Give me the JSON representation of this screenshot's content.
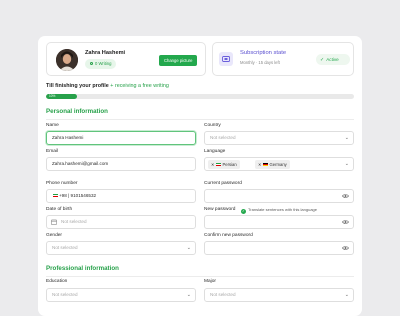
{
  "profile": {
    "name": "Zahra Hashemi",
    "badge": "0 Writing",
    "change_picture": "Change picture"
  },
  "subscription": {
    "title": "Subscription state",
    "detail": "Monthly · 15 days left",
    "status": "Active"
  },
  "progress": {
    "title": "Till finishing your profile",
    "extra": "+ receiving a free writing",
    "percent_label": "10%",
    "value": 0.1
  },
  "personal": {
    "title": "Personal information",
    "fields": {
      "name": {
        "label": "Name",
        "value": "Zahra Hashemi"
      },
      "country": {
        "label": "Country",
        "placeholder": "Not selected"
      },
      "email": {
        "label": "Email",
        "value": "Zahra.hashemi@gmail.com"
      },
      "language": {
        "label": "Language",
        "tags": [
          "Persian",
          "Germany"
        ],
        "translate_label": "Translate sentences with this language",
        "translate_checked": true
      },
      "phone": {
        "label": "Phone number",
        "value": "+98 | 9101546532"
      },
      "current_password": {
        "label": "Current password"
      },
      "dob": {
        "label": "Date of birth",
        "placeholder": "Not selected"
      },
      "new_password": {
        "label": "New password"
      },
      "gender": {
        "label": "Gender",
        "placeholder": "Not selected"
      },
      "confirm_password": {
        "label": "Confirm new password"
      }
    }
  },
  "professional": {
    "title": "Professional information",
    "fields": {
      "education": {
        "label": "Education",
        "placeholder": "Not selected"
      },
      "major": {
        "label": "Major",
        "placeholder": "Not selected"
      }
    }
  },
  "colors": {
    "brand_green": "#27a14a",
    "subscription_purple": "#5a4fd0",
    "background": "#ebebed"
  },
  "icons": {
    "chevron": "chevron-down-icon",
    "eye": "eye-icon",
    "calendar": "calendar-icon",
    "check": "check-icon",
    "close": "close-icon"
  }
}
